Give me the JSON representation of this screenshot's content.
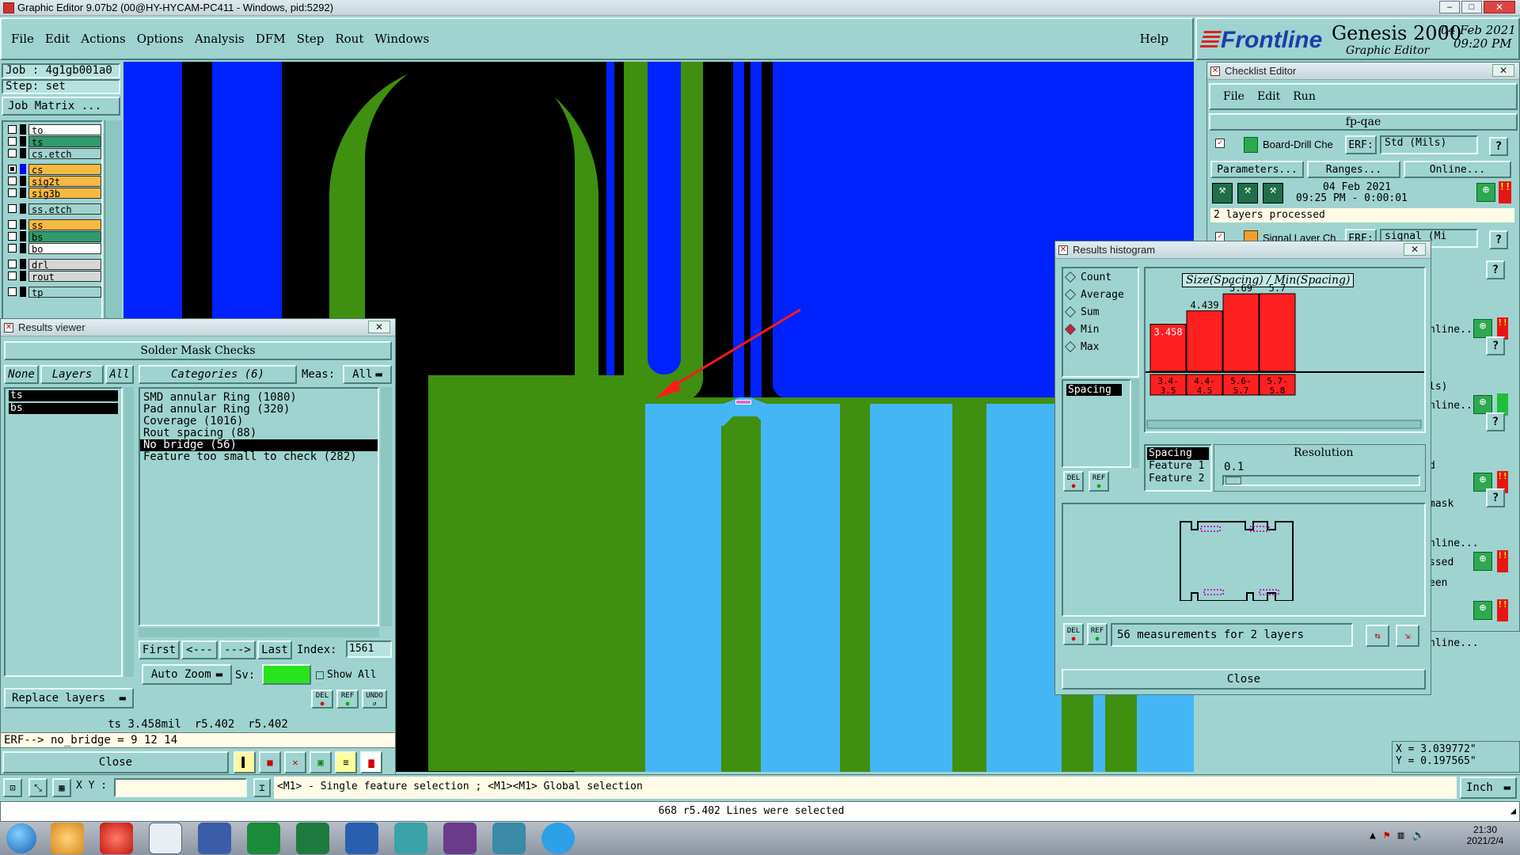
{
  "window_title": "Graphic Editor 9.07b2 (00@HY-HYCAM-PC411 - Windows, pid:5292)",
  "menu": [
    "File",
    "Edit",
    "Actions",
    "Options",
    "Analysis",
    "DFM",
    "Step",
    "Rout",
    "Windows"
  ],
  "menu_help": "Help",
  "brand": {
    "logo": "Frontline",
    "product": "Genesis 2000",
    "subtitle": "Graphic Editor",
    "date": "04 Feb 2021",
    "time": "09:20 PM"
  },
  "job": {
    "job_label": "Job : 4g1gb001a0",
    "step_label": "Step: set",
    "matrix_button": "Job Matrix ..."
  },
  "layers": [
    {
      "name": "to",
      "color": "#ffffff",
      "checked": false
    },
    {
      "name": "ts",
      "color": "#2e9c6a",
      "checked": false
    },
    {
      "name": "cs.etch",
      "color": "#9fd3cf",
      "checked": false
    },
    {
      "name": "cs",
      "color": "#f5b942",
      "checked": true,
      "swatch": "#0000ff"
    },
    {
      "name": "sig2t",
      "color": "#f5b942",
      "checked": false
    },
    {
      "name": "sig3b",
      "color": "#f5b942",
      "checked": false
    },
    {
      "name": "ss.etch",
      "color": "#9fd3cf",
      "checked": false
    },
    {
      "name": "ss",
      "color": "#f5b942",
      "checked": false
    },
    {
      "name": "bs",
      "color": "#2e9c6a",
      "checked": false
    },
    {
      "name": "bo",
      "color": "#ffffff",
      "checked": false
    },
    {
      "name": "drl",
      "color": "#d6d6d6",
      "checked": false
    },
    {
      "name": "rout",
      "color": "#d6d6d6",
      "checked": false
    },
    {
      "name": "tp",
      "color": "#9fd3cf",
      "checked": false
    }
  ],
  "results_viewer": {
    "title": "Results viewer",
    "header": "Solder Mask Checks",
    "none_btn": "None",
    "layers_btn": "Layers",
    "all_btn": "All",
    "layer_list": [
      "ts",
      "bs"
    ],
    "categories_label": "Categories (6)",
    "meas_label": "Meas:",
    "meas_value": "All",
    "categories": [
      "SMD annular Ring (1080)",
      "Pad annular Ring (320)",
      "Coverage (1016)",
      "Rout spacing (88)",
      "No bridge (56)",
      "Feature too small to check (282)"
    ],
    "selected_category": 4,
    "nav": {
      "first": "First",
      "prev": "<---",
      "next": "--->",
      "last": "Last",
      "index_label": "Index:",
      "index_value": "1561"
    },
    "zoom": "Auto Zoom",
    "sv_label": "Sv:",
    "show_all": "Show All",
    "replace_layers": "Replace layers",
    "del": "DEL",
    "ref": "REF",
    "undo": "UNDO",
    "status_line": "ts 3.458mil  r5.402  r5.402",
    "erf_line": "ERF--> no_bridge = 9 12 14",
    "close": "Close"
  },
  "checklist": {
    "title": "Checklist Editor",
    "menu": [
      "File",
      "Edit",
      "Run"
    ],
    "name": "fp-qae",
    "rows": [
      {
        "label": "Board-Drill Che",
        "erf": "ERF:",
        "param": "Std (Mils)",
        "date": "04 Feb 2021",
        "time": "09:25 PM - 0:00:01",
        "status": "2 layers processed"
      },
      {
        "label": "Signal Layer Ch",
        "erf": "ERF:",
        "param": "signal (Mi"
      }
    ],
    "buttons": [
      "Parameters...",
      "Ranges...",
      "Online..."
    ],
    "partial_labels": [
      "nline...",
      "ls)",
      "nline...",
      "d",
      "mask",
      "nline...",
      "ssed",
      "een",
      "nline..."
    ]
  },
  "histogram": {
    "title": "Results histogram",
    "options": [
      "Count",
      "Average",
      "Sum",
      "Min",
      "Max"
    ],
    "selected_option": "Min",
    "list_item": "Spacing",
    "chart_title": "Size(Spacing) / Min(Spacing)",
    "bar_labels": [
      "3.458",
      "4.439",
      "5.69",
      "5.7"
    ],
    "bin_labels_top": [
      "3.4-",
      "4.4-",
      "5.6-",
      "5.7-"
    ],
    "bin_labels_bottom": [
      "3.5",
      "4.5",
      "5.7",
      "5.8"
    ],
    "fields": [
      "Spacing",
      "Feature 1",
      "Feature 2"
    ],
    "resolution_label": "Resolution",
    "resolution_value": "0.1",
    "measurements": "56 measurements for 2 layers",
    "close": "Close",
    "del": "DEL",
    "ref": "REF"
  },
  "chart_data": {
    "type": "bar",
    "title": "Size(Spacing) / Min(Spacing)",
    "categories": [
      "3.4-3.5",
      "4.4-4.5",
      "5.6-5.7",
      "5.7-5.8"
    ],
    "values": [
      3.458,
      4.439,
      5.69,
      5.7
    ],
    "color": "#ff2020"
  },
  "coords": {
    "x": "X = 3.039772\"",
    "y": "Y = 0.197565\""
  },
  "bottom_bar": {
    "xy_label": "X Y :",
    "hint": "<M1> - Single feature selection ; <M1><M1> Global selection",
    "unit": "Inch",
    "status": "668 r5.402 Lines were selected"
  },
  "taskbar": {
    "time": "21:30",
    "date": "2021/2/4"
  }
}
